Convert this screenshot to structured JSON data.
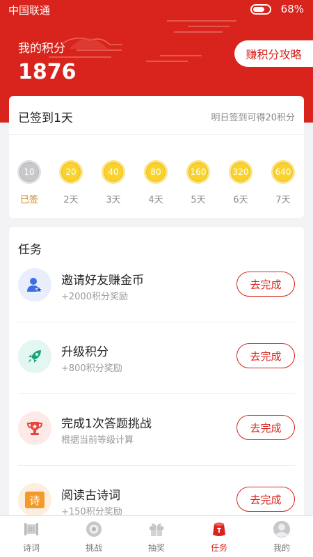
{
  "status_bar": {
    "carrier": "中国联通",
    "battery": "68%"
  },
  "header": {
    "points_label": "我的积分",
    "points_value": "1876",
    "strategy_button": "赚积分攻略"
  },
  "checkin": {
    "title": "已签到1天",
    "tip": "明日签到可得20积分",
    "days": [
      {
        "points": "10",
        "label": "已签",
        "done": true
      },
      {
        "points": "20",
        "label": "2天",
        "done": false
      },
      {
        "points": "40",
        "label": "3天",
        "done": false
      },
      {
        "points": "80",
        "label": "4天",
        "done": false
      },
      {
        "points": "160",
        "label": "5天",
        "done": false
      },
      {
        "points": "320",
        "label": "6天",
        "done": false
      },
      {
        "points": "640",
        "label": "7天",
        "done": false
      }
    ]
  },
  "tasks": {
    "title": "任务",
    "items": [
      {
        "name": "邀请好友赚金币",
        "reward": "+2000积分奖励",
        "button": "去完成",
        "icon": "invite-user-icon"
      },
      {
        "name": "升级积分",
        "reward": "+800积分奖励",
        "button": "去完成",
        "icon": "rocket-icon"
      },
      {
        "name": "完成1次答题挑战",
        "reward": "根据当前等级计算",
        "button": "去完成",
        "icon": "trophy-icon"
      },
      {
        "name": "阅读古诗词",
        "reward": "+150积分奖励",
        "button": "去完成",
        "icon": "poem-icon",
        "icon_text": "诗"
      }
    ]
  },
  "tabbar": {
    "items": [
      {
        "label": "诗词",
        "icon": "scroll-icon",
        "active": false
      },
      {
        "label": "挑战",
        "icon": "target-icon",
        "active": false
      },
      {
        "label": "抽奖",
        "icon": "gift-icon",
        "active": false
      },
      {
        "label": "任务",
        "icon": "task-bag-icon",
        "active": true
      },
      {
        "label": "我的",
        "icon": "profile-icon",
        "active": false
      }
    ]
  },
  "colors": {
    "brand_red": "#d8241c",
    "coin_gold": "#f9d32c"
  }
}
